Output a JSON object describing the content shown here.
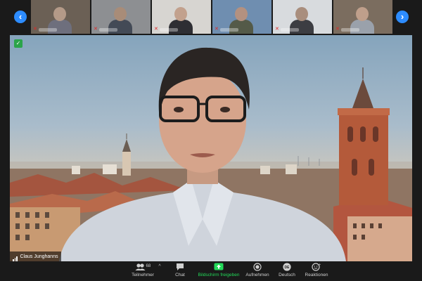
{
  "strip": {
    "thumbnails": [
      {
        "bg": "#6b6055",
        "skin": "#b49a88",
        "shirt": "#6e6f7d"
      },
      {
        "bg": "#8d8f92",
        "skin": "#a88c78",
        "shirt": "#434a56"
      },
      {
        "bg": "#d7d5d1",
        "skin": "#c2a18d",
        "shirt": "#2e2e33"
      },
      {
        "bg": "#6f8eb0",
        "skin": "#b39180",
        "shirt": "#545a48"
      },
      {
        "bg": "#d8dbde",
        "skin": "#a98e7d",
        "shirt": "#3c3d42"
      },
      {
        "bg": "#7b6d5f",
        "skin": "#bf9f8b",
        "shirt": "#9aa1ab"
      }
    ]
  },
  "main": {
    "participant_name": "Claus Junghanns"
  },
  "toolbar": {
    "participants_label": "Teilnehmer",
    "participants_count": "68",
    "chat_label": "Chat",
    "share_label": "Bildschirm freigeben",
    "record_label": "Aufnehmen",
    "language_label": "Deutsch",
    "language_code": "DE",
    "reactions_label": "Reaktionen"
  },
  "colors": {
    "accent": "#2d8cff",
    "share_green": "#23d959",
    "mic_muted_red": "#e02828",
    "secure_green": "#2ba44a"
  }
}
